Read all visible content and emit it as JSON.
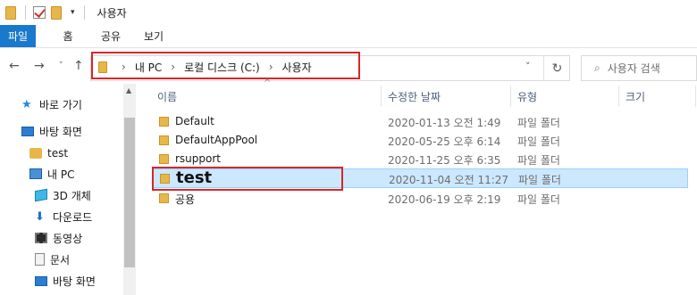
{
  "window": {
    "title": "사용자"
  },
  "ribbon": {
    "tabs": [
      "파일",
      "홈",
      "공유",
      "보기"
    ]
  },
  "address": {
    "crumbs": [
      "내 PC",
      "로컬 디스크 (C:)",
      "사용자"
    ],
    "search_placeholder": "사용자 검색"
  },
  "sidebar": {
    "items": [
      {
        "label": "바로 가기",
        "icon": "star-icon"
      },
      {
        "label": "바탕 화면",
        "icon": "desktop-icon"
      },
      {
        "label": "test",
        "icon": "user-icon"
      },
      {
        "label": "내 PC",
        "icon": "pc-icon"
      },
      {
        "label": "3D 개체",
        "icon": "3d-objects-icon"
      },
      {
        "label": "다운로드",
        "icon": "download-icon"
      },
      {
        "label": "동영상",
        "icon": "video-icon"
      },
      {
        "label": "문서",
        "icon": "document-icon"
      },
      {
        "label": "바탕 화면",
        "icon": "desktop-icon"
      }
    ]
  },
  "columns": {
    "name": "이름",
    "date": "수정한 날짜",
    "type": "유형",
    "size": "크기"
  },
  "files": [
    {
      "name": "Default",
      "date": "2020-01-13 오전 1:49",
      "type": "파일 폴더"
    },
    {
      "name": "DefaultAppPool",
      "date": "2020-05-25 오후 6:14",
      "type": "파일 폴더"
    },
    {
      "name": "rsupport",
      "date": "2020-11-25 오후 6:35",
      "type": "파일 폴더"
    },
    {
      "name": "test",
      "date": "2020-11-04 오전 11:27",
      "type": "파일 폴더"
    },
    {
      "name": "공용",
      "date": "2020-06-19 오후 2:19",
      "type": "파일 폴더"
    }
  ],
  "colors": {
    "accent": "#1979ca",
    "highlight": "#d8262b",
    "selection": "#cce8ff"
  }
}
